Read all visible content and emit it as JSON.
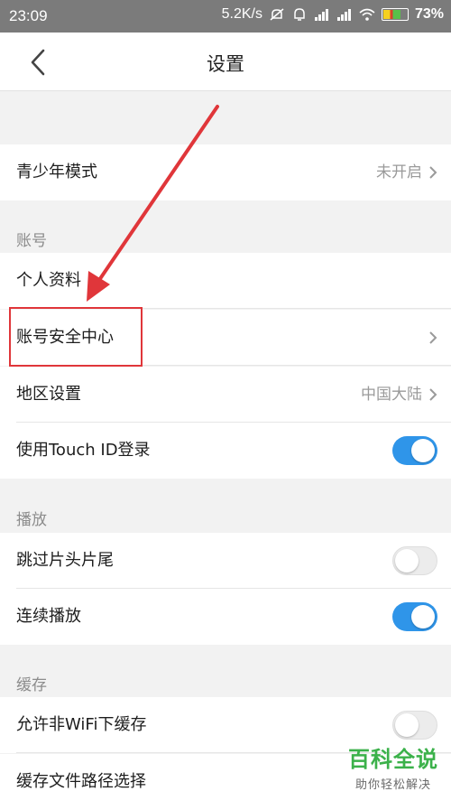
{
  "status_bar": {
    "time": "23:09",
    "network_speed": "5.2K/s",
    "battery": "73%",
    "icons": [
      "mute-icon",
      "alarm-icon",
      "signal-icon",
      "signal-icon",
      "wifi-icon",
      "battery-icon"
    ]
  },
  "nav": {
    "title": "设置",
    "back_icon": "chevron-left-icon"
  },
  "teen_mode": {
    "label": "青少年模式",
    "value": "未开启"
  },
  "sections": {
    "account": {
      "header": "账号",
      "items": [
        {
          "label": "个人资料"
        },
        {
          "label": "账号安全中心"
        },
        {
          "label": "地区设置",
          "value": "中国大陆"
        },
        {
          "label": "使用Touch ID登录",
          "toggle": "on"
        }
      ]
    },
    "playback": {
      "header": "播放",
      "items": [
        {
          "label": "跳过片头片尾",
          "toggle": "off"
        },
        {
          "label": "连续播放",
          "toggle": "on"
        }
      ]
    },
    "cache": {
      "header": "缓存",
      "items": [
        {
          "label": "允许非WiFi下缓存",
          "toggle": "off"
        },
        {
          "label": "缓存文件路径选择"
        }
      ]
    }
  },
  "annotation": {
    "highlight_color": "#e0363a"
  },
  "colors": {
    "toggle_on": "#2f95e9",
    "watermark": "#3bb14a"
  },
  "watermark": {
    "title": "百科全说",
    "subtitle": "助你轻松解决"
  }
}
